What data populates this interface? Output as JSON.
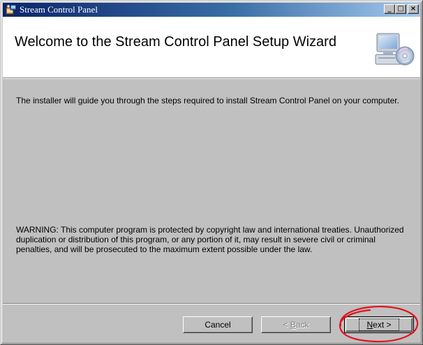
{
  "window": {
    "title": "Stream Control Panel",
    "caption_buttons": {
      "minimize": "_",
      "maximize": "□",
      "close": "×"
    }
  },
  "header": {
    "title": "Welcome to the Stream Control Panel Setup Wizard",
    "icon": "computer-with-cd-icon"
  },
  "body": {
    "intro": "The installer will guide you through the steps required to install Stream Control Panel on your computer.",
    "warning": "WARNING: This computer program is protected by copyright law and international treaties. Unauthorized duplication or distribution of this program, or any portion of it, may result in severe civil or criminal penalties, and will be prosecuted to the maximum extent possible under the law."
  },
  "buttons": {
    "cancel": "Cancel",
    "back_prefix": "< ",
    "back_accel": "B",
    "back_rest": "ack",
    "next_accel": "N",
    "next_rest": "ext >"
  },
  "colors": {
    "titlebar_start": "#0a246a",
    "titlebar_end": "#a6caf0",
    "annotation": "#e0141e"
  }
}
